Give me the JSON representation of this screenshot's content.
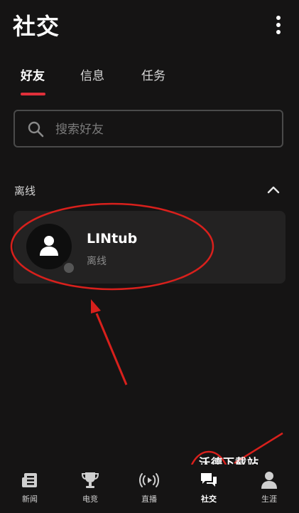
{
  "header": {
    "title": "社交"
  },
  "tabs": [
    {
      "label": "好友",
      "active": true
    },
    {
      "label": "信息",
      "active": false
    },
    {
      "label": "任务",
      "active": false
    }
  ],
  "search": {
    "placeholder": "搜索好友"
  },
  "section": {
    "title": "离线"
  },
  "friends": [
    {
      "name": "LINtub",
      "status": "离线"
    }
  ],
  "watermark": "沃德下载站",
  "bottom_nav": [
    {
      "label": "新闻",
      "icon": "news-icon",
      "active": false
    },
    {
      "label": "电竞",
      "icon": "trophy-icon",
      "active": false
    },
    {
      "label": "直播",
      "icon": "live-broadcast-icon",
      "active": false
    },
    {
      "label": "社交",
      "icon": "chat-bubbles-icon",
      "active": true
    },
    {
      "label": "生涯",
      "icon": "profile-icon",
      "active": false
    }
  ],
  "colors": {
    "accent": "#e0303a",
    "background": "#151414",
    "card": "#232222",
    "annotation": "#d8201c"
  }
}
